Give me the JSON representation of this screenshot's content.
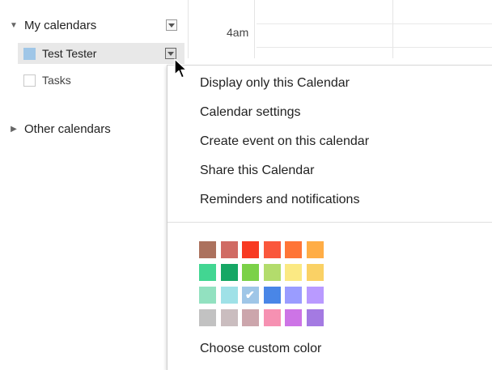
{
  "sidebar": {
    "my_calendars_label": "My calendars",
    "other_calendars_label": "Other calendars",
    "calendars": [
      {
        "label": "Test Tester",
        "color": "#9fc6e7",
        "checked": true
      },
      {
        "label": "Tasks",
        "color": "#ffffff",
        "checked": false
      }
    ]
  },
  "grid": {
    "time_label": "4am"
  },
  "menu": {
    "items": [
      "Display only this Calendar",
      "Calendar settings",
      "Create event on this calendar",
      "Share this Calendar",
      "Reminders and notifications"
    ],
    "palette": [
      [
        "#ac725e",
        "#d06b64",
        "#f83a22",
        "#fa573c",
        "#ff7537",
        "#ffad46"
      ],
      [
        "#42d692",
        "#16a765",
        "#7bd148",
        "#b3dc6c",
        "#fbe983",
        "#fad165"
      ],
      [
        "#92e1c0",
        "#9fe1e7",
        "#9fc6e7",
        "#4986e7",
        "#9a9cff",
        "#b99aff"
      ],
      [
        "#c2c2c2",
        "#cabdbf",
        "#cca6ac",
        "#f691b2",
        "#cd74e6",
        "#a47ae2"
      ]
    ],
    "selected_color": "#9fc6e7",
    "custom_color_label": "Choose custom color"
  }
}
